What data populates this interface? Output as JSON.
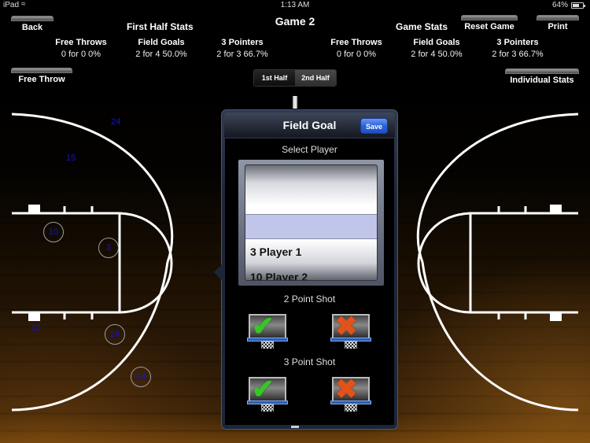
{
  "status_bar": {
    "carrier": "iPad",
    "wifi_icon": "wifi-icon",
    "time": "1:13 AM",
    "battery_percent": "64%",
    "battery_icon": "battery-icon"
  },
  "header": {
    "game_title": "Game 2",
    "back_label": "Back",
    "free_throw_label": "Free Throw",
    "reset_game_label": "Reset Game",
    "print_label": "Print",
    "individual_stats_label": "Individual Stats"
  },
  "first_half": {
    "title": "First Half Stats",
    "stats": [
      {
        "label": "Free Throws",
        "value": "0 for 0  0%"
      },
      {
        "label": "Field Goals",
        "value": "2 for 4  50.0%"
      },
      {
        "label": "3 Pointers",
        "value": "2 for 3  66.7%"
      }
    ]
  },
  "game_stats": {
    "title": "Game Stats",
    "stats": [
      {
        "label": "Free Throws",
        "value": "0 for 0  0%"
      },
      {
        "label": "Field Goals",
        "value": "2 for 4  50.0%"
      },
      {
        "label": "3 Pointers",
        "value": "2 for 3  66.7%"
      }
    ]
  },
  "half_selector": {
    "options": [
      "1st Half",
      "2nd Half"
    ],
    "selected": "2nd Half"
  },
  "court_markers": [
    {
      "number": "24",
      "circled": false,
      "result": "made"
    },
    {
      "number": "15",
      "circled": false,
      "result": "made"
    },
    {
      "number": "10",
      "circled": true,
      "result": "missed"
    },
    {
      "number": "3",
      "circled": true,
      "result": "missed"
    },
    {
      "number": "10",
      "circled": false,
      "result": "made"
    },
    {
      "number": "24",
      "circled": true,
      "result": "missed"
    },
    {
      "number": "24",
      "circled": true,
      "result": "missed"
    }
  ],
  "popover": {
    "title": "Field Goal",
    "save_label": "Save",
    "select_player_label": "Select Player",
    "players": [
      "3 Player 1",
      "10 Player 2"
    ],
    "two_point_label": "2 Point Shot",
    "three_point_label": "3 Point Shot",
    "made_icon": "check-icon",
    "missed_icon": "x-icon",
    "colors": {
      "made": "#3bc42a",
      "missed": "#e0531c",
      "save": "#2d63d8"
    }
  }
}
